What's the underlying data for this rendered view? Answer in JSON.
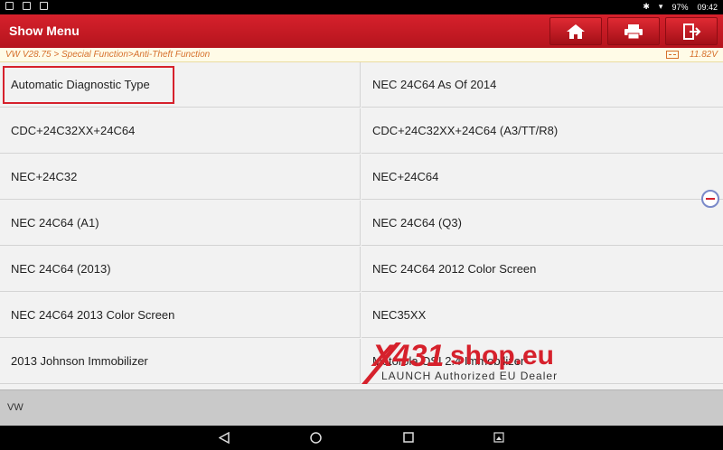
{
  "status_bar": {
    "time": "09:42",
    "battery": "97%"
  },
  "header": {
    "title": "Show Menu",
    "home_icon": "home-icon",
    "print_icon": "print-icon",
    "exit_icon": "exit-icon"
  },
  "path_bar": {
    "path": "VW V28.75 > Special Function>Anti-Theft Function",
    "voltage": "11.82V"
  },
  "menu": {
    "left": [
      "Automatic Diagnostic Type",
      "CDC+24C32XX+24C64",
      "NEC+24C32",
      "NEC 24C64 (A1)",
      "NEC 24C64 (2013)",
      "NEC 24C64 2013 Color Screen",
      "2013 Johnson Immobilizer"
    ],
    "right": [
      "NEC 24C64 As Of 2014",
      "CDC+24C32XX+24C64 (A3/TT/R8)",
      "NEC+24C64",
      "NEC 24C64 (Q3)",
      "NEC 24C64 2012 Color Screen",
      "NEC35XX",
      "Motorola OSI 2.4 Immobilizer"
    ],
    "selected": "Automatic Diagnostic Type"
  },
  "footer": {
    "label": "VW"
  },
  "watermark": {
    "brand_x": "X431",
    "brand_shop": "shop.eu",
    "tagline": "LAUNCH Authorized EU Dealer"
  }
}
